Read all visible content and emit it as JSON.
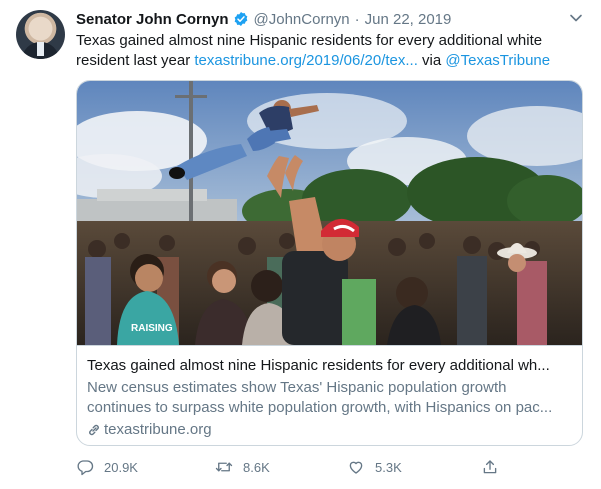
{
  "tweet": {
    "author_name": "Senator John Cornyn",
    "handle": "@JohnCornyn",
    "separator": "·",
    "date": "Jun 22, 2019",
    "text_main": "Texas gained almost nine Hispanic residents for every additional white resident last year ",
    "text_link": "texastribune.org/2019/06/20/tex...",
    "text_via": " via ",
    "text_mention": "@TexasTribune"
  },
  "card": {
    "title": "Texas gained almost nine Hispanic residents for every additional wh...",
    "description_line1": "New census estimates show Texas' Hispanic population growth",
    "description_line2": "continues to surpass white population growth, with Hispanics on pac...",
    "domain": "texastribune.org",
    "shirt_text": "RAISING"
  },
  "actions": {
    "replies": "20.9K",
    "retweets": "8.6K",
    "likes": "5.3K"
  },
  "colors": {
    "link": "#1b95e0",
    "secondary": "#657786",
    "border": "#ccd6dd",
    "verified": "#1da1f2"
  }
}
